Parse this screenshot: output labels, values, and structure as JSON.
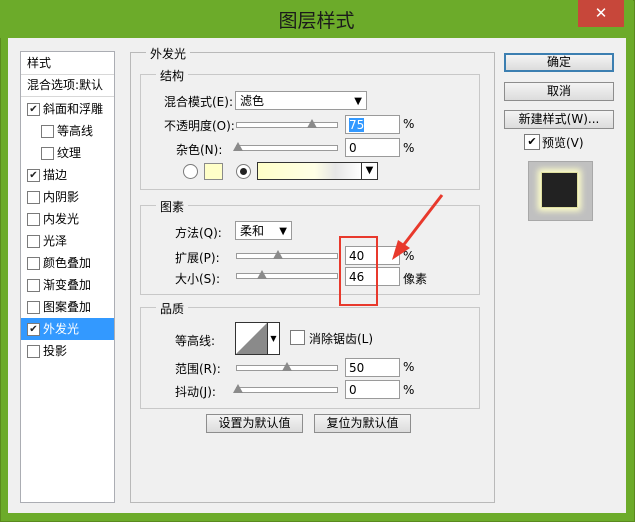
{
  "window": {
    "title": "图层样式",
    "close_glyph": "✕"
  },
  "sidebar": {
    "header": "样式",
    "items": [
      {
        "label": "混合选项:默认",
        "has_checkbox": false,
        "checked": false
      },
      {
        "label": "斜面和浮雕",
        "has_checkbox": true,
        "checked": true
      },
      {
        "label": "等高线",
        "has_checkbox": true,
        "checked": false
      },
      {
        "label": "纹理",
        "has_checkbox": true,
        "checked": false
      },
      {
        "label": "描边",
        "has_checkbox": true,
        "checked": true
      },
      {
        "label": "内阴影",
        "has_checkbox": true,
        "checked": false
      },
      {
        "label": "内发光",
        "has_checkbox": true,
        "checked": false
      },
      {
        "label": "光泽",
        "has_checkbox": true,
        "checked": false
      },
      {
        "label": "颜色叠加",
        "has_checkbox": true,
        "checked": false
      },
      {
        "label": "渐变叠加",
        "has_checkbox": true,
        "checked": false
      },
      {
        "label": "图案叠加",
        "has_checkbox": true,
        "checked": false
      },
      {
        "label": "外发光",
        "has_checkbox": true,
        "checked": true,
        "selected": true
      },
      {
        "label": "投影",
        "has_checkbox": true,
        "checked": false
      }
    ]
  },
  "panel": {
    "title": "外发光",
    "structure": {
      "title": "结构",
      "blend_mode_label": "混合模式(E):",
      "blend_mode_value": "滤色",
      "opacity_label": "不透明度(O):",
      "opacity_value": "75",
      "opacity_unit": "%",
      "noise_label": "杂色(N):",
      "noise_value": "0",
      "noise_unit": "%",
      "glow_color": "#ffffc8"
    },
    "elements": {
      "title": "图素",
      "technique_label": "方法(Q):",
      "technique_value": "柔和",
      "spread_label": "扩展(P):",
      "spread_value": "40",
      "spread_unit": "%",
      "size_label": "大小(S):",
      "size_value": "46",
      "size_unit": "像素"
    },
    "quality": {
      "title": "品质",
      "contour_label": "等高线:",
      "antialias_label": "消除锯齿(L)",
      "range_label": "范围(R):",
      "range_value": "50",
      "range_unit": "%",
      "jitter_label": "抖动(J):",
      "jitter_value": "0",
      "jitter_unit": "%"
    },
    "make_default_label": "设置为默认值",
    "reset_default_label": "复位为默认值"
  },
  "actions": {
    "ok_label": "确定",
    "cancel_label": "取消",
    "new_style_label": "新建样式(W)...",
    "preview_label": "预览(V)",
    "preview_checked": true
  },
  "colors": {
    "title_bar": "#6cab2a",
    "selection": "#3399ff",
    "annotation": "#e8392c"
  }
}
